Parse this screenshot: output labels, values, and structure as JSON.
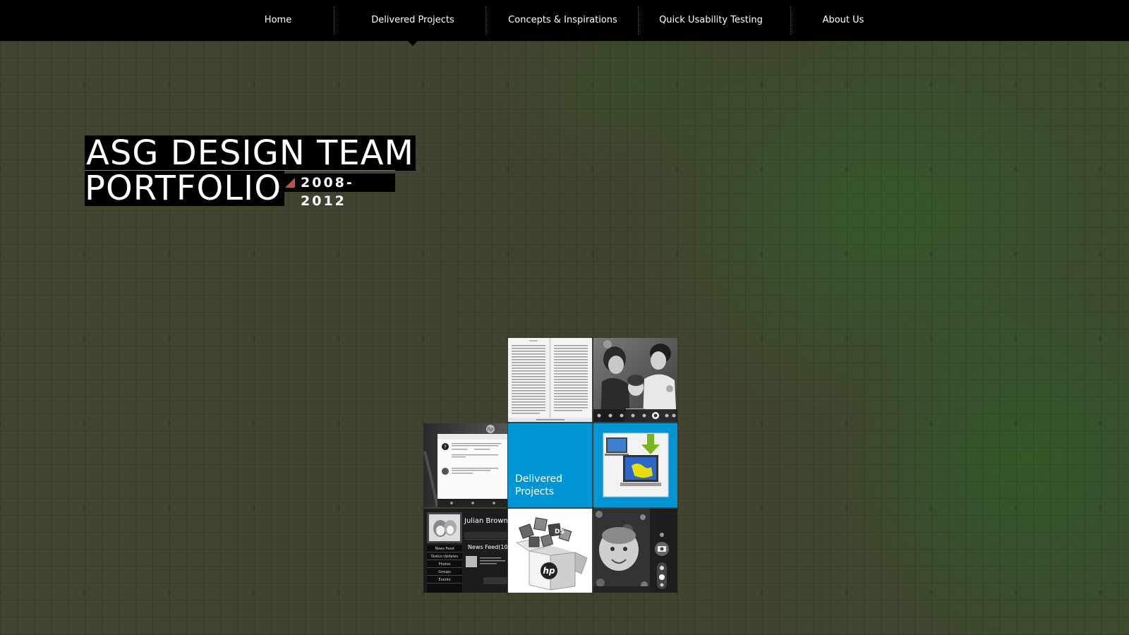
{
  "nav": {
    "items": [
      {
        "label": "Home"
      },
      {
        "label": "Delivered Projects"
      },
      {
        "label": "Concepts & Inspirations"
      },
      {
        "label": "Quick Usability Testing"
      },
      {
        "label": "About Us"
      }
    ],
    "active_index": 1
  },
  "hero": {
    "title_line1": "ASG DESIGN TEAM",
    "title_line2": "PORTFOLIO",
    "years": "2008-2012"
  },
  "tiles": {
    "delivered_label_line1": "Delivered",
    "delivered_label_line2": "Projects",
    "social_name": "Julian Brown",
    "social_newsfeed": "News Feed(10)",
    "social_menu": [
      "News Feed",
      "Status Updates",
      "Photos",
      "Groups",
      "Events"
    ],
    "hp_logo": "hp",
    "box_badge": "DS"
  },
  "colors": {
    "nav_bg": "#000000",
    "accent_blue": "#0096d6",
    "accent_red": "#c0504d",
    "background": "#404230"
  }
}
